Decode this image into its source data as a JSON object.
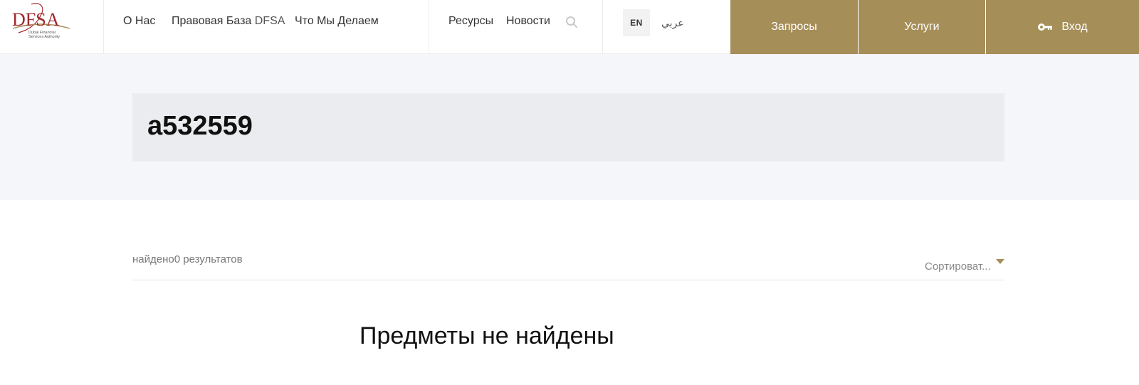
{
  "header": {
    "logo": {
      "text": "DFSA",
      "tagline_line1": "Dubai Financial",
      "tagline_line2": "Services Authority"
    },
    "nav_main": [
      {
        "label": "О Нас"
      },
      {
        "label_prefix": "Правовая База ",
        "label_brand": "DFSA"
      },
      {
        "label": "Что Мы Делаем"
      }
    ],
    "nav_secondary": [
      {
        "label": "Ресурсы"
      },
      {
        "label": "Новости"
      }
    ],
    "search_icon": "search-icon",
    "lang_en": "EN",
    "lang_ar": "عربي",
    "btn_requests": "Запросы",
    "btn_services": "Услуги",
    "btn_login": "Вход",
    "login_icon": "key-icon"
  },
  "search": {
    "query": "a532559"
  },
  "results": {
    "count_text": "найдено0 результатов",
    "sort_label": "Сортироват...",
    "sort_icon": "caret-down-icon",
    "empty_message": "Предметы не найдены"
  },
  "colors": {
    "accent_gold": "#a68e59",
    "band_bg": "#f5f6f9",
    "search_box_bg": "#ebecef",
    "logo_red": "#a2272d"
  }
}
